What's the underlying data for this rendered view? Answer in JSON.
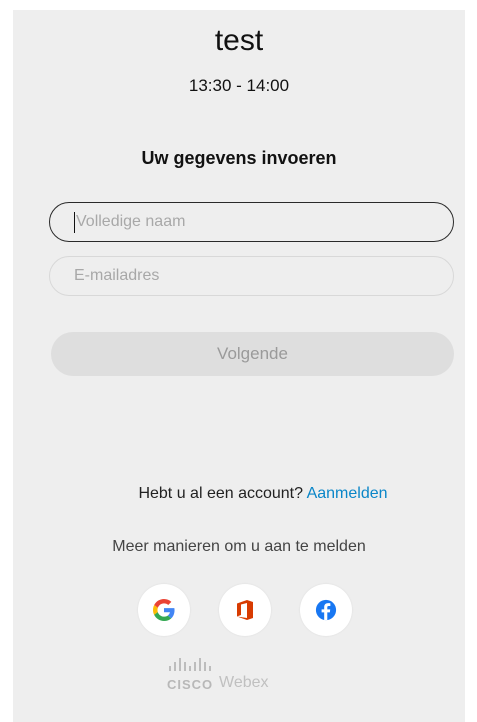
{
  "meeting": {
    "title": "test",
    "time": "13:30 - 14:00"
  },
  "form": {
    "heading": "Uw gegevens invoeren",
    "name_placeholder": "Volledige naam",
    "email_placeholder": "E-mailadres",
    "next_label": "Volgende"
  },
  "signin": {
    "prompt": "Hebt u al een account?",
    "link": "Aanmelden",
    "more_ways": "Meer manieren om u aan te melden",
    "providers": [
      "google-icon",
      "office-icon",
      "facebook-icon"
    ]
  },
  "footer": {
    "cisco": "CISCO",
    "webex": "Webex"
  },
  "colors": {
    "background": "#eeeeee",
    "link": "#0a86c8",
    "button_disabled": "#dedede",
    "google_blue": "#4285F4",
    "google_red": "#EA4335",
    "google_yellow": "#FBBC05",
    "google_green": "#34A853",
    "office_orange": "#D83B01",
    "facebook_blue": "#1877F2"
  }
}
